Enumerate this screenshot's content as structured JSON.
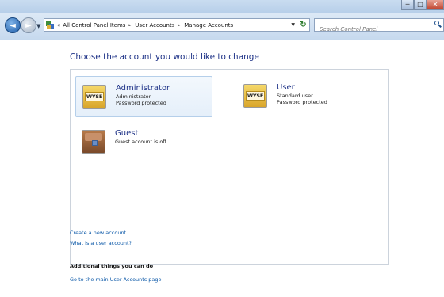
{
  "window_controls": {
    "minimize": "─",
    "maximize": "□",
    "close": "✕"
  },
  "toolbar": {
    "back_glyph": "◄",
    "forward_glyph": "►",
    "recent_glyph": "▼",
    "crumb_lead": "«",
    "breadcrumbs": [
      "All Control Panel Items",
      "User Accounts",
      "Manage Accounts"
    ],
    "breadcrumb_sep": "►",
    "address_dropdown": "▼",
    "refresh_glyph": "↻"
  },
  "search": {
    "placeholder": "Search Control Panel"
  },
  "main": {
    "heading": "Choose the account you would like to change",
    "accounts": [
      {
        "name": "Administrator",
        "type": "Administrator",
        "status": "Password protected",
        "picture": "WYSE",
        "selected": true
      },
      {
        "name": "User",
        "type": "Standard user",
        "status": "Password protected",
        "picture": "WYSE",
        "selected": false
      },
      {
        "name": "Guest",
        "status": "Guest account is off",
        "picture": "guest-briefcase-icon",
        "selected": false
      }
    ],
    "links": [
      "Create a new account",
      "What is a user account?"
    ],
    "additional_heading": "Additional things you can do",
    "additional_links": [
      "Go to the main User Accounts page"
    ]
  },
  "colors": {
    "heading": "#1e3287",
    "link": "#0b58a8",
    "toolbar_bg": "#c6d9ee"
  }
}
